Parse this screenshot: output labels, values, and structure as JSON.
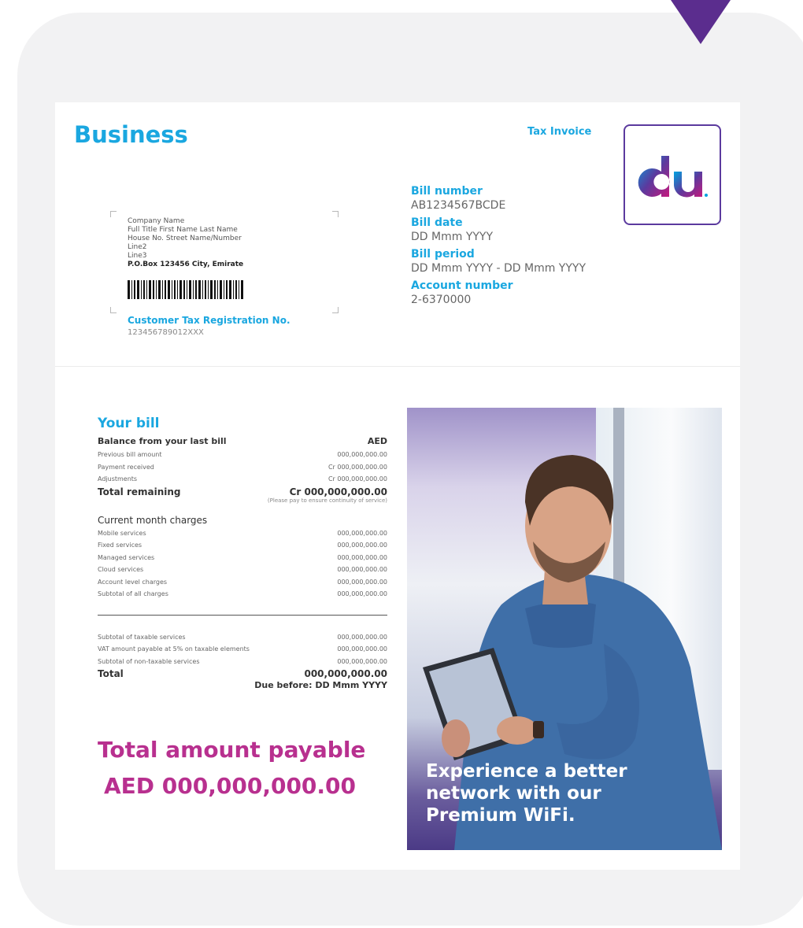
{
  "header": {
    "brand": "Business",
    "doc_type": "Tax Invoice",
    "logo_text": "du"
  },
  "address": {
    "lines": [
      "Company Name",
      "Full Title First Name Last Name",
      "House No. Street Name/Number",
      "Line2",
      "Line3"
    ],
    "po_box": "P.O.Box 123456 City, Emirate",
    "tax_reg_label": "Customer Tax Registration No.",
    "tax_reg_value": "123456789012XXX"
  },
  "meta": {
    "bill_number_label": "Bill number",
    "bill_number": "AB1234567BCDE",
    "bill_date_label": "Bill date",
    "bill_date": "DD Mmm YYYY",
    "bill_period_label": "Bill period",
    "bill_period": "DD Mmm YYYY - DD Mmm YYYY",
    "account_number_label": "Account number",
    "account_number": "2-6370000"
  },
  "bill": {
    "title": "Your bill",
    "balance_head": "Balance from your last bill",
    "currency": "AED",
    "balance_rows": [
      {
        "label": "Previous bill amount",
        "value": "000,000,000.00"
      },
      {
        "label": "Payment received",
        "value": "Cr 000,000,000.00"
      },
      {
        "label": "Adjustments",
        "value": "Cr 000,000,000.00"
      }
    ],
    "total_remaining_label": "Total remaining",
    "total_remaining_value": "Cr 000,000,000.00",
    "note": "(Please pay to ensure continuity of service)",
    "current_head": "Current month charges",
    "current_rows": [
      {
        "label": "Mobile services",
        "value": "000,000,000.00"
      },
      {
        "label": "Fixed services",
        "value": "000,000,000.00"
      },
      {
        "label": "Managed services",
        "value": "000,000,000.00"
      },
      {
        "label": "Cloud services",
        "value": "000,000,000.00"
      },
      {
        "label": "Account level charges",
        "value": "000,000,000.00"
      },
      {
        "label": "Subtotal of all charges",
        "value": "000,000,000.00"
      }
    ],
    "tax_rows": [
      {
        "label": "Subtotal of taxable services",
        "value": "000,000,000.00"
      },
      {
        "label": "VAT amount payable at 5% on taxable elements",
        "value": "000,000,000.00"
      },
      {
        "label": "Subtotal of non-taxable services",
        "value": "000,000,000.00"
      }
    ],
    "total_label": "Total",
    "total_value": "000,000,000.00",
    "due_before": "Due before: DD Mmm YYYY"
  },
  "payable": {
    "label": "Total amount payable",
    "value": "AED 000,000,000.00"
  },
  "promo": {
    "caption_1": "Experience a better",
    "caption_2": "network with our",
    "caption_3": "Premium WiFi."
  },
  "colors": {
    "accent_blue": "#1aa7e0",
    "accent_magenta": "#b8308f",
    "brand_purple": "#5b2d8e"
  }
}
